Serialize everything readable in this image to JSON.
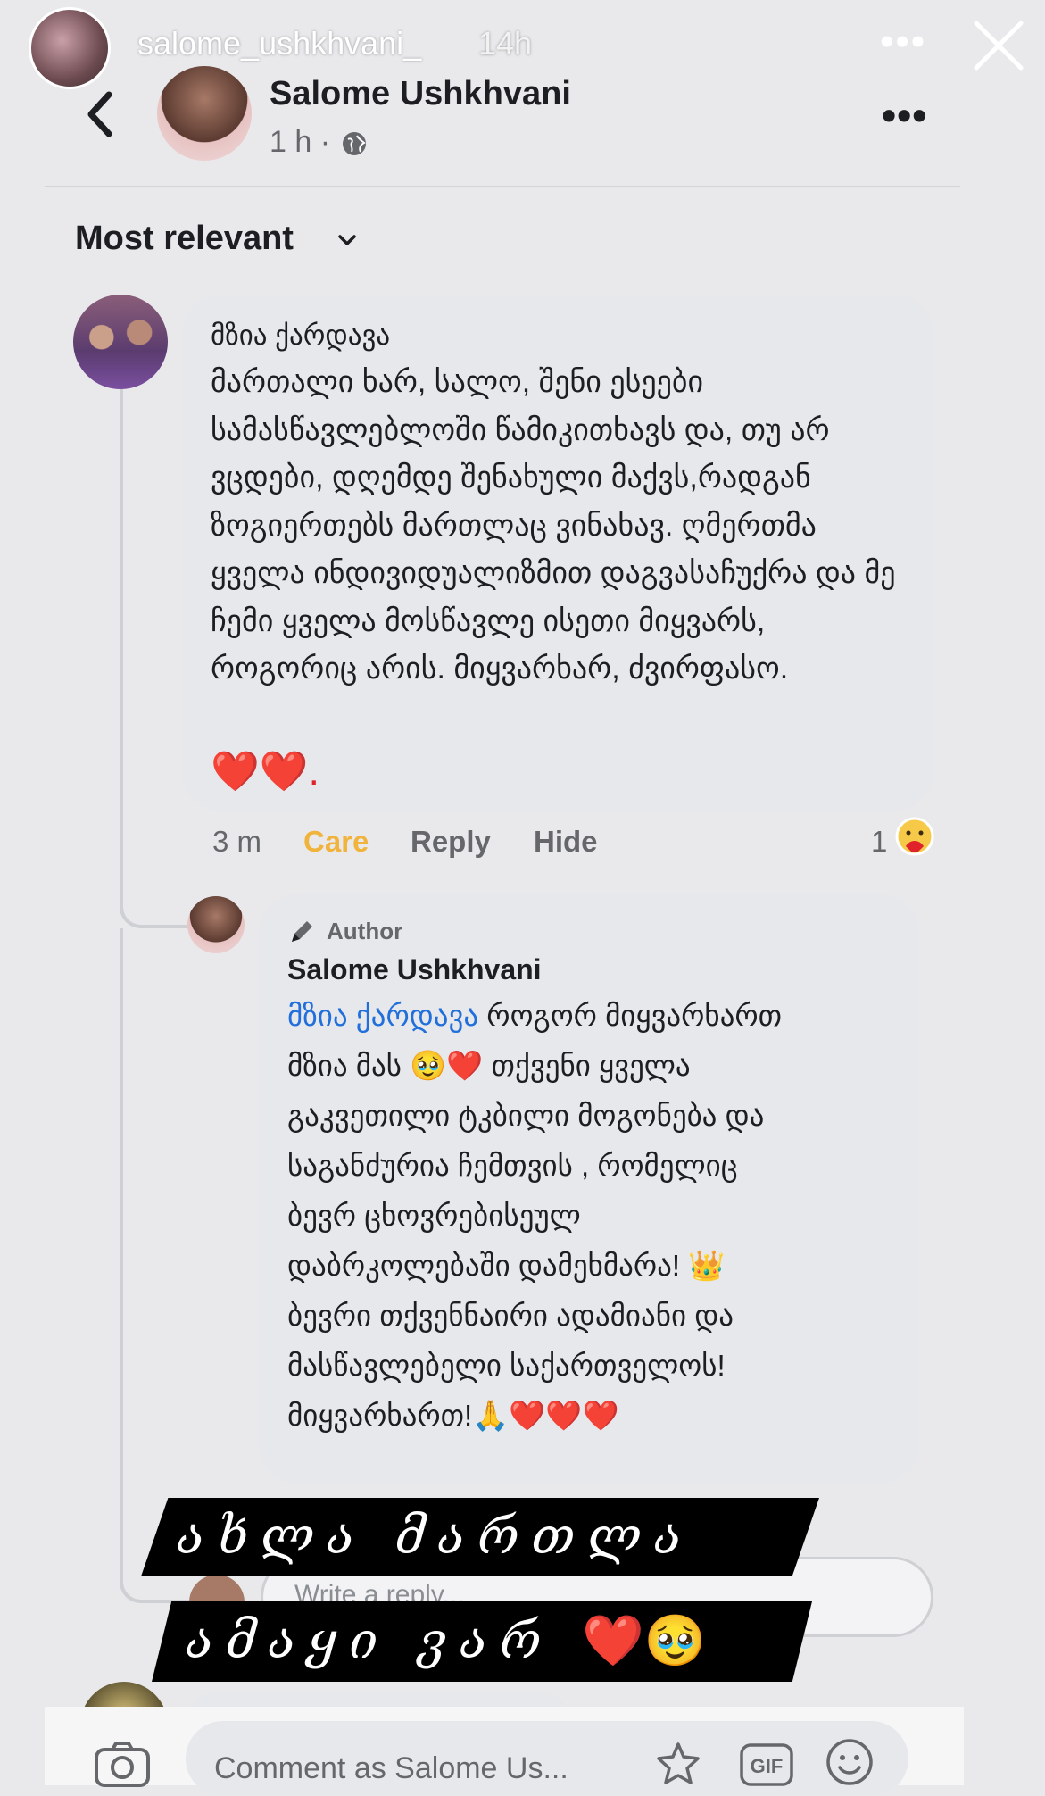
{
  "story": {
    "username": "salome_ushkhvani_",
    "age": "14h",
    "more": "•••"
  },
  "post": {
    "author": "Salome Ushkhvani",
    "time": "1 h ·",
    "more": "•••"
  },
  "sort": {
    "label": "Most relevant"
  },
  "comment": {
    "author": "მზია ქარდავა",
    "text": "მართალი ხარ, სალო, შენი ესეები სამასწავლებლოში წამიკითხავს და, თუ არ ვცდები, დღემდე შენახული მაქვს,რადგან ზოგიერთებს მართლაც ვინახავ. ღმერთმა ყველა ინდივიდუალიზმით დაგვასაჩუქრა და მე ჩემი ყველა მოსწავლე ისეთი მიყვარს, როგორიც არის. მიყვარხარ, ძვირფასო.",
    "hearts": "❤️❤️.",
    "time": "3 m",
    "care": "Care",
    "reply": "Reply",
    "hide": "Hide",
    "reaction_count": "1"
  },
  "reply": {
    "badge": "Author",
    "author": "Salome Ushkhvani",
    "mention": "მზია ქარდავა",
    "line1": " როგორ მიყვარხართ",
    "line2": "მზია მას 🥹❤️ თქვენი ყველა",
    "line3": "გაკვეთილი ტკბილი მოგონება  და",
    "line4": "საგანძურია ჩემთვის , რომელიც",
    "line5": "ბევრ ცხოვრებისეულ",
    "line6": "დაბრკოლებაში დამეხმარა! 👑",
    "line7": "ბევრი თქვენნაირი ადამიანი  და",
    "line8": "მასწავლებელი საქართველოს!",
    "line9": "მიყვარხართ!🙏❤️❤️❤️"
  },
  "reply_input": {
    "placeholder": "Write a reply..."
  },
  "overlay": {
    "line1": "ახლა მართლა",
    "line2": "ამაყი ვარ",
    "line2_emoji": "❤️🥹"
  },
  "composer": {
    "placeholder": "Comment as Salome Us...",
    "gif": "GIF"
  },
  "colors": {
    "care": "#f0b43c",
    "mention": "#216fdb",
    "heart": "#e0222b"
  }
}
